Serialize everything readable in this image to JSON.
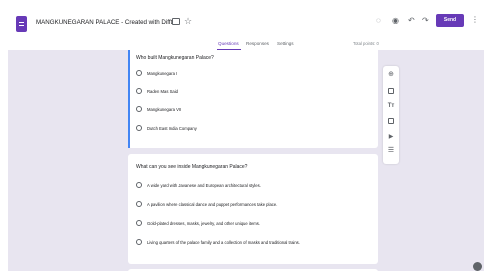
{
  "header": {
    "title": "MANGKUNEGARAN PALACE - Created with Difft",
    "send_label": "Send",
    "icons": [
      "palette-icon",
      "preview-icon",
      "undo-icon",
      "redo-icon",
      "more-vert-icon"
    ]
  },
  "tabs": [
    {
      "label": "Questions",
      "active": true
    },
    {
      "label": "Responses",
      "active": false
    },
    {
      "label": "Settings",
      "active": false
    }
  ],
  "total_points": "Total points: 0",
  "questions": [
    {
      "text": "Who built Mangkunegaran Palace?",
      "options": [
        "Mangkunegara I",
        "Raden Mas Said",
        "Mangkunegara VII",
        "Dutch East India Company"
      ]
    },
    {
      "text": "What can you see inside Mangkunegaran Palace?",
      "options": [
        "A wide yard with Javanese and European architectural styles.",
        "A pavilion where classical dance and puppet performances take place.",
        "Gold-plated dresses, masks, jewelry, and other unique items.",
        "Living quarters of the palace family and a collection of masks and traditional trains."
      ]
    }
  ],
  "toolbar": [
    "add-question-icon",
    "import-questions-icon",
    "add-title-icon",
    "add-image-icon",
    "add-video-icon",
    "add-section-icon"
  ],
  "colors": {
    "accent": "#673ab7",
    "background": "#e8e5f0",
    "focus_border": "#4285f4"
  }
}
